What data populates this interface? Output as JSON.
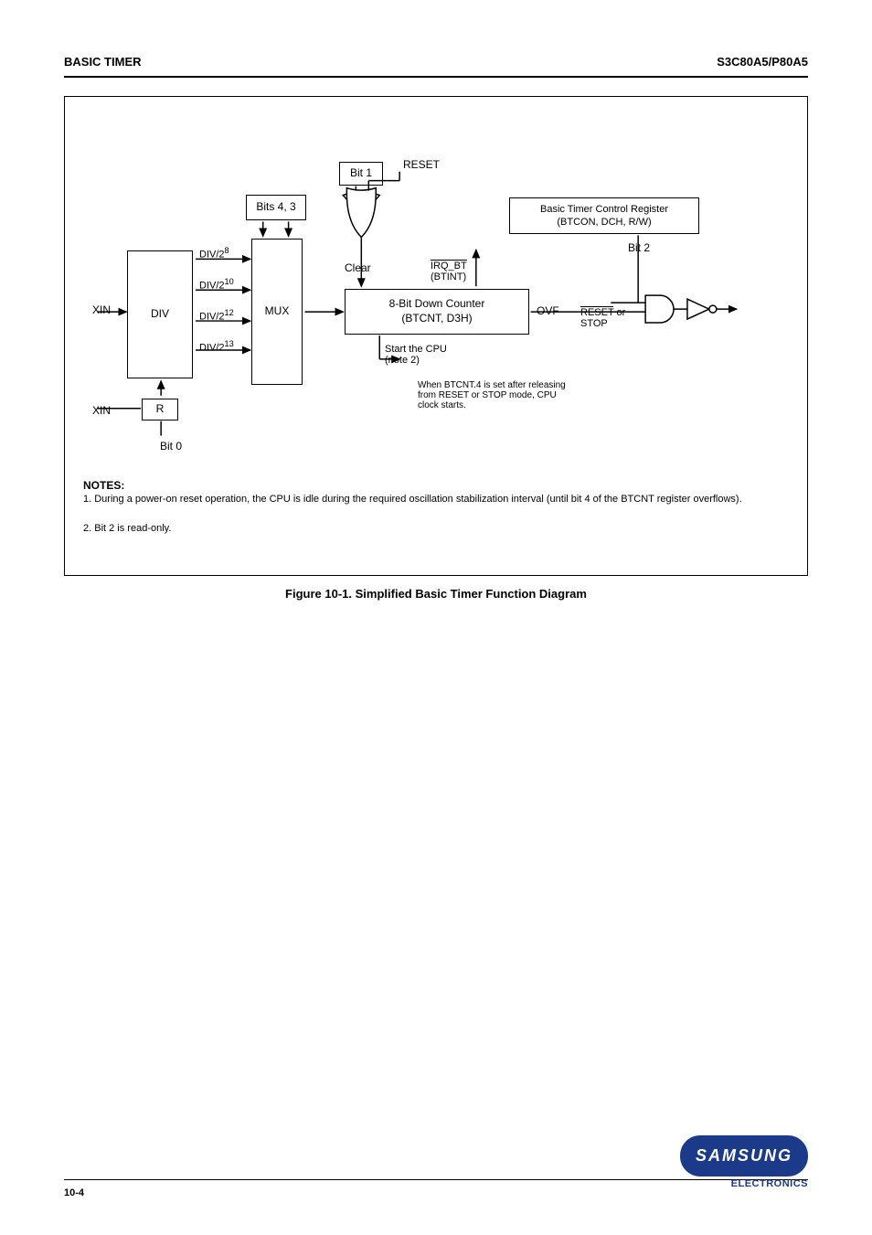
{
  "header": {
    "left": "BASIC TIMER",
    "right": "S3C80A5/P80A5"
  },
  "blocks": {
    "divider": "DIV",
    "divider_reset": "R",
    "xin": "XIN",
    "bits_43": "Bits 4, 3",
    "mux": "MUX",
    "bit1": "Bit 1",
    "reset": "RESET",
    "clear": "Clear",
    "down_counter": "8-Bit Down Counter\n(BTCNT, D3H)",
    "bt_control": "Basic Timer Control Register\n(BTCON, DCH, R/W)",
    "bit_notes": {
      "b0": "Bit 0",
      "b2": "Bit 2",
      "irq_pos": "When BTCNT.4 is set\nafter releasing from\nRESET or STOP mode,\nCPU clock starts.",
      "ovf": "OVF",
      "start": "Start the CPU\n(note 2)"
    },
    "notes_title": "NOTES:",
    "note1": "1. During a power-on reset operation, the CPU is idle during the required oscillation stabilization interval (until bit 4 of the BTCNT register overflows).",
    "note2": "2. Bit 2 is read-only."
  },
  "caption": "Figure 10-1. Simplified Basic Timer Function Diagram",
  "footer": {
    "page": "10-4",
    "logo_text": "SAMSUNG",
    "electronics": "ELECTRONICS"
  }
}
